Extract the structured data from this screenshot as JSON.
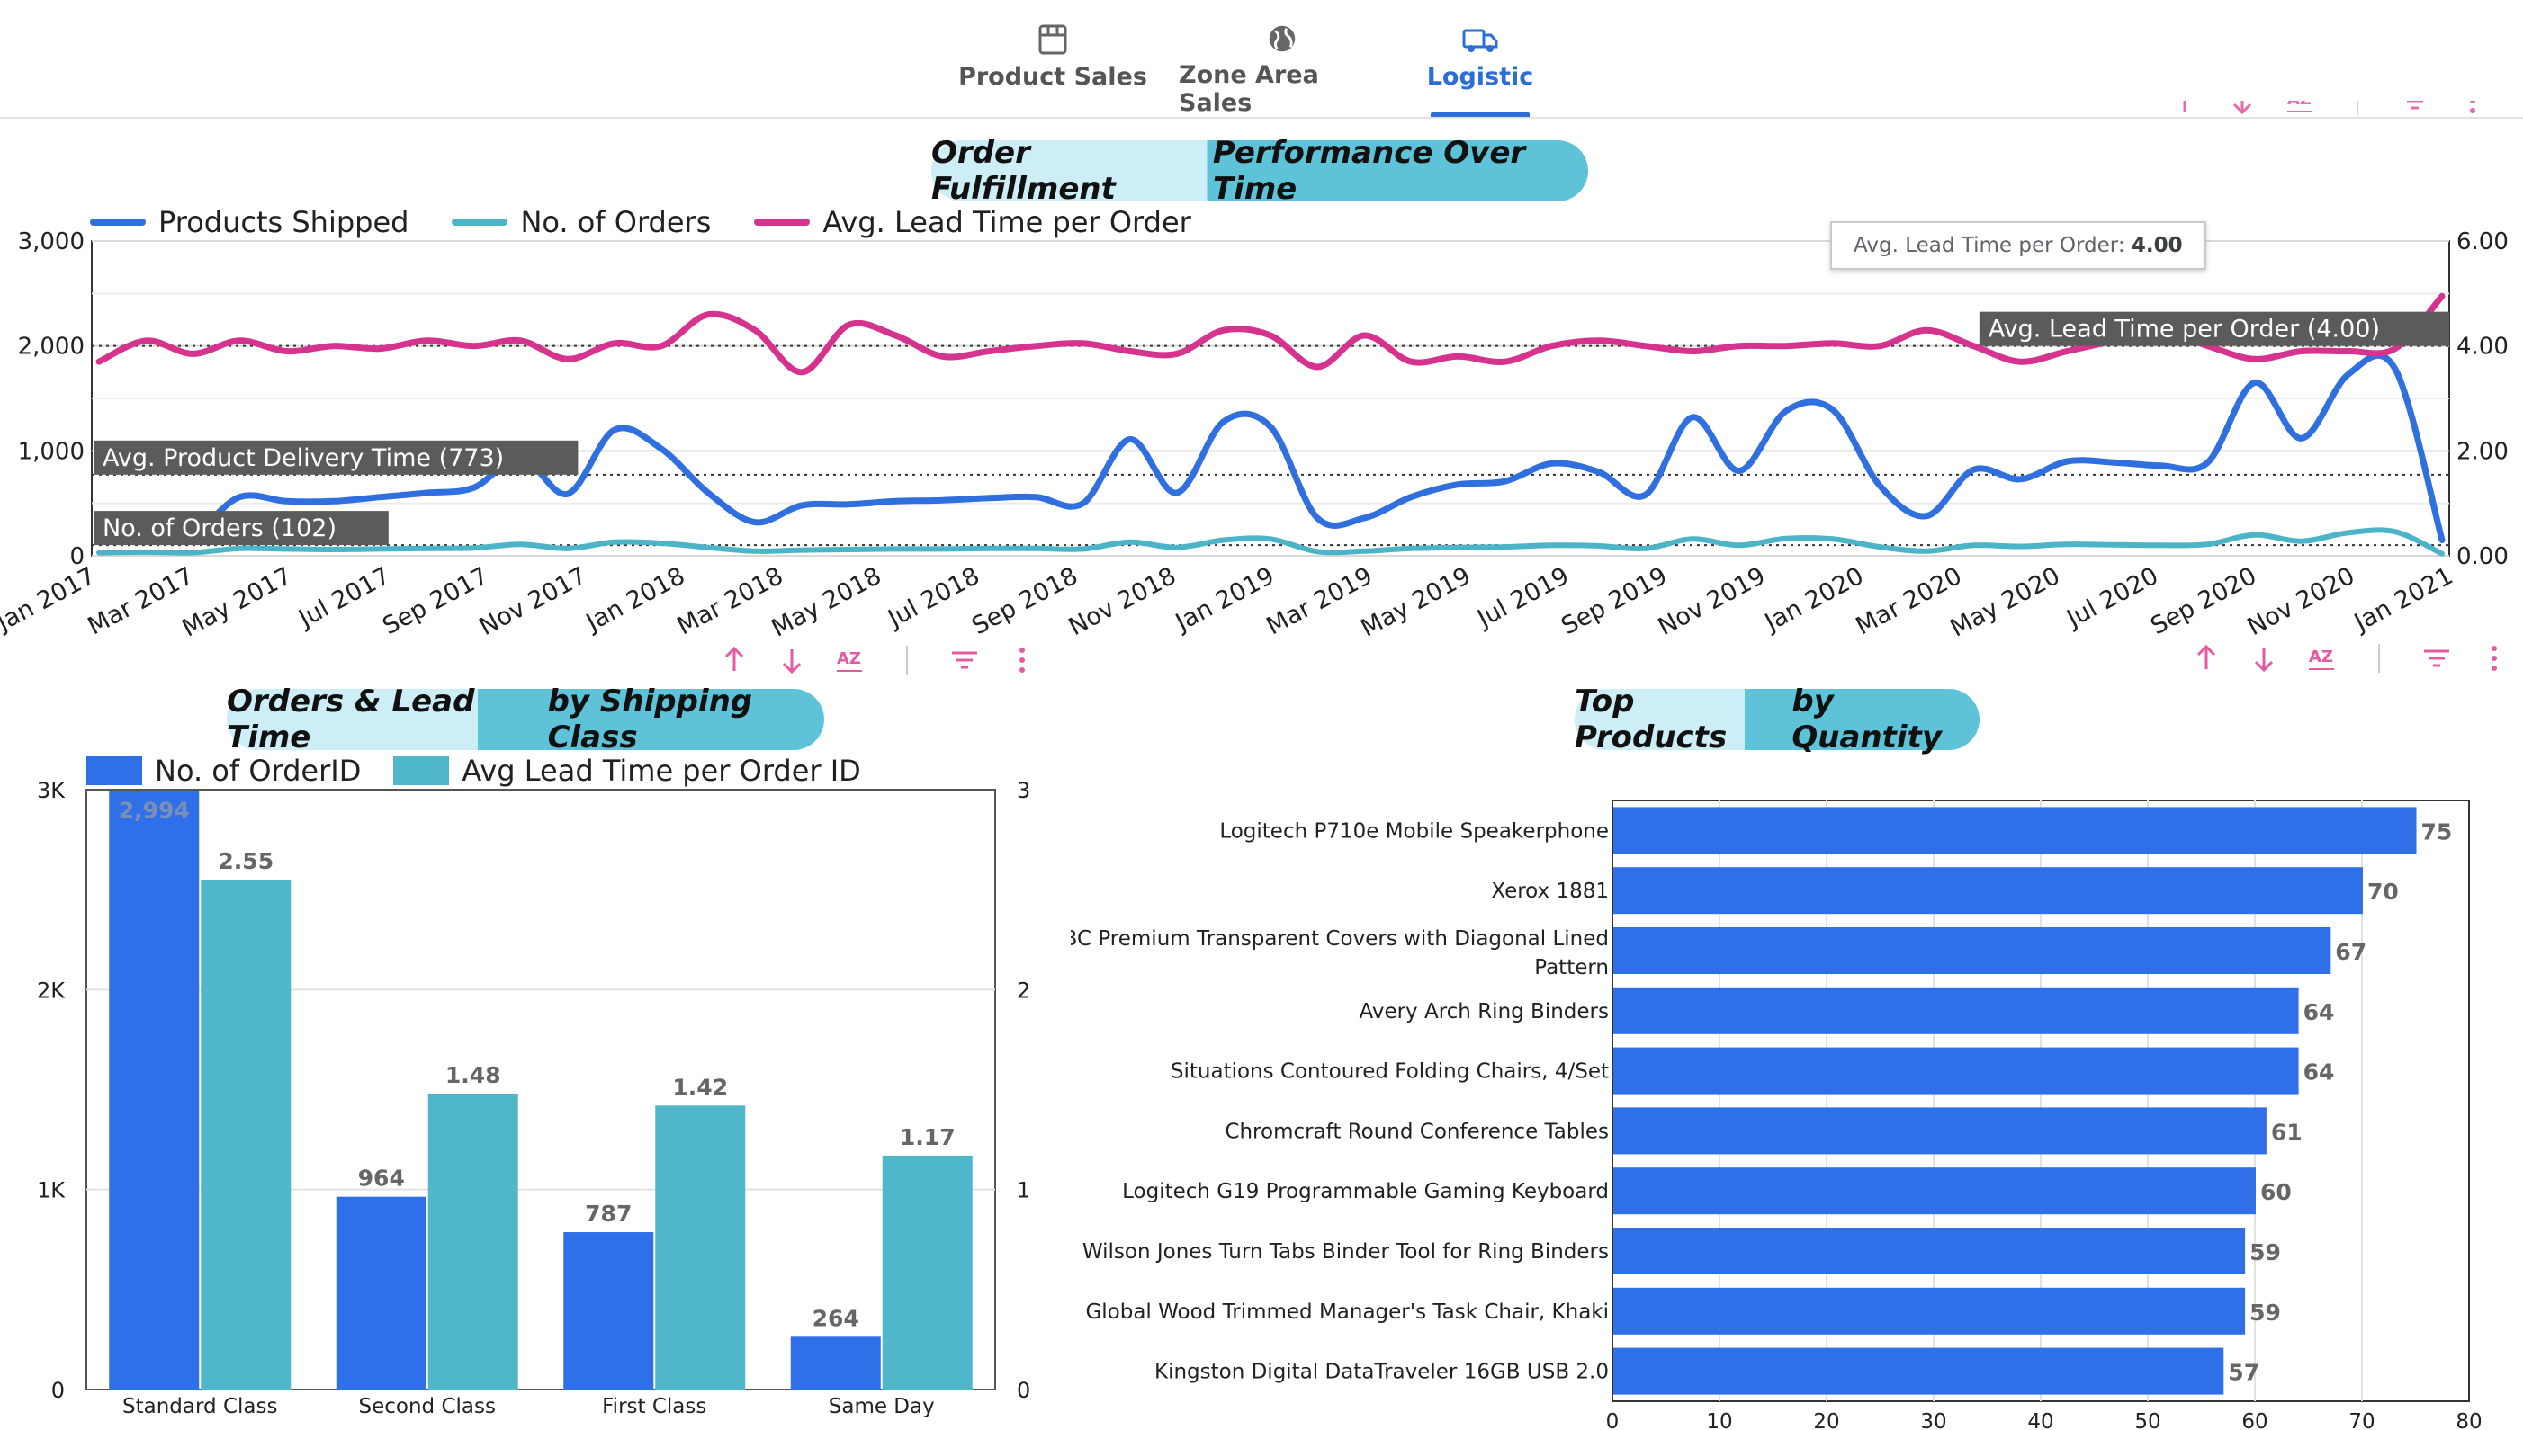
{
  "tabs": [
    {
      "label": "Product Sales",
      "icon": "store-icon",
      "active": false
    },
    {
      "label": "Zone Area Sales",
      "icon": "globe-icon",
      "active": false
    },
    {
      "label": "Logistic",
      "icon": "truck-icon",
      "active": true
    }
  ],
  "colors": {
    "accent": "#2b6fd6",
    "products_shipped": "#2f6fde",
    "orders": "#4cb4c7",
    "lead_time": "#d6338f",
    "bar_blue": "#2f6fe8",
    "bar_teal": "#50b6c9",
    "toolbar_pink": "#e55aa2"
  },
  "tooltip": {
    "label": "Avg. Lead Time per Order:",
    "value": "4.00"
  },
  "chart_data": [
    {
      "type": "line",
      "title": "Order Fulfillment Performance Over Time",
      "title_parts": [
        "Order Fulfillment",
        "Performance Over Time"
      ],
      "y_left": {
        "min": 0,
        "max": 3000,
        "ticks": [
          "0",
          "1,000",
          "2,000",
          "3,000"
        ]
      },
      "y_right": {
        "min": 0,
        "max": 6,
        "ticks": [
          "0.00",
          "2.00",
          "4.00",
          "6.00"
        ]
      },
      "x_labels": [
        "Jan 2017",
        "Mar 2017",
        "May 2017",
        "Jul 2017",
        "Sep 2017",
        "Nov 2017",
        "Jan 2018",
        "Mar 2018",
        "May 2018",
        "Jul 2018",
        "Sep 2018",
        "Nov 2018",
        "Jan 2019",
        "Mar 2019",
        "May 2019",
        "Jul 2019",
        "Sep 2019",
        "Nov 2019",
        "Jan 2020",
        "Mar 2020",
        "May 2020",
        "Jul 2020",
        "Sep 2020",
        "Nov 2020",
        "Jan 2021"
      ],
      "series": [
        {
          "name": "Products Shipped",
          "axis": "left",
          "values": [
            230,
            270,
            220,
            560,
            520,
            520,
            560,
            600,
            650,
            940,
            590,
            1200,
            1020,
            600,
            320,
            480,
            490,
            520,
            530,
            550,
            560,
            500,
            1110,
            600,
            1280,
            1230,
            360,
            360,
            560,
            680,
            710,
            880,
            800,
            580,
            1320,
            810,
            1380,
            1390,
            670,
            380,
            820,
            730,
            900,
            890,
            860,
            890,
            1650,
            1120,
            1730,
            1780,
            150
          ]
        },
        {
          "name": "No. of Orders",
          "axis": "left",
          "values": [
            30,
            35,
            30,
            70,
            65,
            60,
            65,
            70,
            75,
            110,
            70,
            130,
            120,
            80,
            45,
            55,
            60,
            65,
            65,
            70,
            70,
            65,
            130,
            80,
            150,
            160,
            40,
            45,
            70,
            80,
            85,
            100,
            95,
            70,
            160,
            100,
            165,
            160,
            85,
            45,
            100,
            90,
            110,
            105,
            100,
            110,
            200,
            140,
            220,
            230,
            20
          ]
        },
        {
          "name": "Avg. Lead Time per Order",
          "axis": "right",
          "values": [
            3.7,
            4.1,
            3.85,
            4.1,
            3.9,
            4.0,
            3.95,
            4.1,
            4.0,
            4.1,
            3.75,
            4.05,
            4.0,
            4.6,
            4.3,
            3.5,
            4.4,
            4.2,
            3.8,
            3.9,
            4.0,
            4.05,
            3.9,
            3.85,
            4.3,
            4.2,
            3.6,
            4.2,
            3.7,
            3.8,
            3.7,
            4.0,
            4.1,
            4.0,
            3.9,
            4.0,
            4.0,
            4.05,
            4.0,
            4.3,
            4.0,
            3.7,
            3.9,
            4.1,
            4.3,
            4.0,
            3.75,
            3.9,
            3.9,
            3.95,
            4.95
          ]
        }
      ],
      "reference_lines": [
        {
          "label": "Avg. Product Delivery Time (773)",
          "axis": "left",
          "value": 773
        },
        {
          "label": "No. of Orders (102)",
          "axis": "left",
          "value": 102
        },
        {
          "label": "Avg. Lead Time per Order (4.00)",
          "axis": "right",
          "value": 4.0
        }
      ]
    },
    {
      "type": "bar",
      "title": "Orders & Lead Time by Shipping Class",
      "title_parts": [
        "Orders & Lead Time",
        "by Shipping Class"
      ],
      "categories": [
        "Standard Class",
        "Second Class",
        "First Class",
        "Same Day"
      ],
      "y_left": {
        "min": 0,
        "max": 3000,
        "ticks": [
          "0",
          "1K",
          "2K",
          "3K"
        ]
      },
      "y_right": {
        "min": 0,
        "max": 3,
        "ticks": [
          "0",
          "1",
          "2",
          "3"
        ]
      },
      "series": [
        {
          "name": "No. of OrderID",
          "axis": "left",
          "values": [
            2994,
            964,
            787,
            264
          ],
          "labels": [
            "2,994",
            "964",
            "787",
            "264"
          ]
        },
        {
          "name": "Avg Lead Time per Order ID",
          "axis": "right",
          "values": [
            2.55,
            1.48,
            1.42,
            1.17
          ],
          "labels": [
            "2.55",
            "1.48",
            "1.42",
            "1.17"
          ]
        }
      ]
    },
    {
      "type": "bar",
      "orientation": "horizontal",
      "title": "Top Products by Quantity",
      "title_parts": [
        "Top Products",
        "by Quantity"
      ],
      "categories": [
        "Logitech P710e Mobile Speakerphone",
        "Xerox 1881",
        "GBC Premium Transparent Covers with Diagonal Lined Pattern",
        "Avery Arch Ring Binders",
        "Situations Contoured Folding Chairs, 4/Set",
        "Chromcraft Round Conference Tables",
        "Logitech G19 Programmable Gaming Keyboard",
        "Wilson Jones Turn Tabs Binder Tool for Ring Binders",
        "Global Wood Trimmed Manager's Task Chair, Khaki",
        "Kingston Digital DataTraveler 16GB USB 2.0"
      ],
      "values": [
        75,
        70,
        67,
        64,
        64,
        61,
        60,
        59,
        59,
        57
      ],
      "x": {
        "min": 0,
        "max": 80,
        "ticks": [
          "0",
          "10",
          "20",
          "30",
          "40",
          "50",
          "60",
          "70",
          "80"
        ]
      }
    }
  ]
}
